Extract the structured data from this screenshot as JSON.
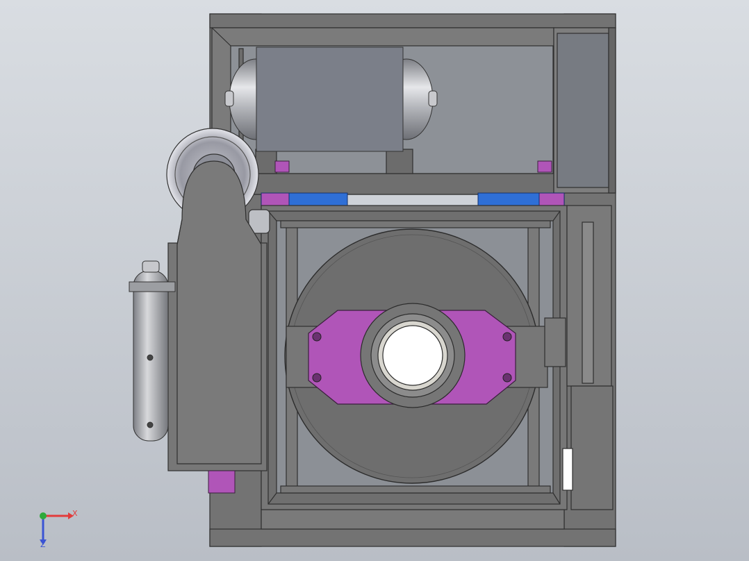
{
  "viewport": {
    "background_top": "#d9dde2",
    "background_bottom": "#b9bec6"
  },
  "model": {
    "frame_color": "#737373",
    "frame_edge": "#2f2f2f",
    "panel_color": "#767676",
    "tank_color": "#a7a9ae",
    "mount_plate_color": "#b055b8",
    "motor_color": "#2f6fd6"
  },
  "triad": {
    "x_label": "X",
    "z_label": "Z",
    "x_color": "#e23b3b",
    "y_color": "#2eaa3b",
    "z_color": "#3b54d4"
  }
}
